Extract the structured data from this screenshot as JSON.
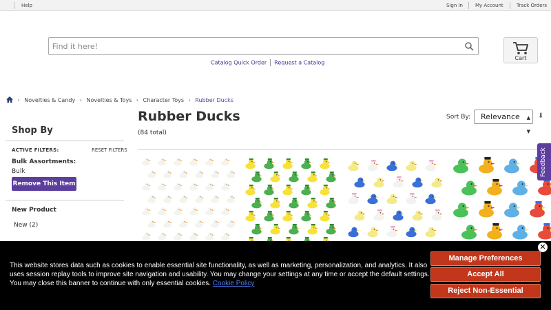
{
  "topbar": {
    "help": "Help",
    "sign_in": "Sign In",
    "my_account": "My Account",
    "track_orders": "Track Orders"
  },
  "search": {
    "placeholder": "Find it here!",
    "icon": "search-icon"
  },
  "cart": {
    "label": "Cart",
    "icon": "cart-icon"
  },
  "quick_links": {
    "catalog_quick_order": "Catalog Quick Order",
    "request_catalog": "Request a Catalog"
  },
  "breadcrumb": {
    "home_icon": "home-icon",
    "items": [
      "Novelties & Candy",
      "Novelties & Toys",
      "Character Toys",
      "Rubber Ducks"
    ]
  },
  "sidebar": {
    "title": "Shop By",
    "active_filters": "ACTIVE FILTERS:",
    "reset_filters": "RESET FILTERS",
    "filter_group": "Bulk Assortments:",
    "filter_value": "Bulk",
    "remove_button": "Remove This Item",
    "new_product_heading": "New Product",
    "new_product_option": "New (2)"
  },
  "main": {
    "title": "Rubber Ducks",
    "total": "(84 total)",
    "sort_label": "Sort By:",
    "sort_value": "Relevance",
    "sort_direction_icon": "sort-arrow-icon"
  },
  "feedback": {
    "label": "Feedback"
  },
  "cookie_banner": {
    "text": "This website stores data such as cookies to enable essential site functionality, as well as marketing, personalization, and analytics. It also uses session replay tools to improve site navigation and usability. You may change your settings at any time or accept the default settings. You may close this banner to continue with only essential cookies.",
    "policy_link": "Cookie Policy",
    "manage_button": "Manage Preferences",
    "accept_button": "Accept All",
    "reject_button": "Reject Non-Essential",
    "close_icon": "close-icon"
  },
  "colors": {
    "brand_purple": "#5c3e9e",
    "cookie_button": "#c2361b",
    "link_blue": "#3b3b8f"
  }
}
